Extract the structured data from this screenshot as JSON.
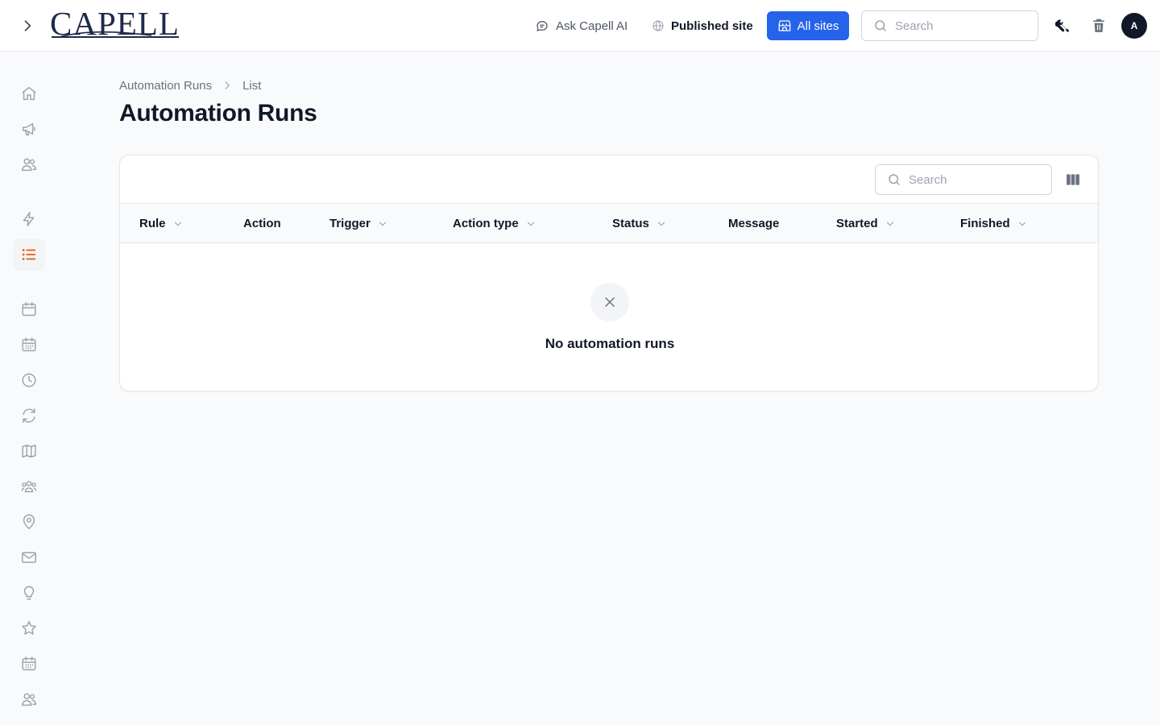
{
  "header": {
    "brand": "CAPELL",
    "ask_ai_label": "Ask Capell AI",
    "published_site_label": "Published site",
    "all_sites_label": "All sites",
    "search_placeholder": "Search",
    "avatar_initial": "A",
    "accent_color": "#2563eb"
  },
  "sidebar": {
    "active_item": "automation-runs",
    "active_color": "#ea580c",
    "items": [
      {
        "icon": "home-icon"
      },
      {
        "icon": "megaphone-icon"
      },
      {
        "icon": "users-icon"
      },
      {
        "icon": "bolt-icon"
      },
      {
        "icon": "list-icon"
      },
      {
        "icon": "calendar-icon"
      },
      {
        "icon": "calendar-days-icon"
      },
      {
        "icon": "clock-icon"
      },
      {
        "icon": "refresh-icon"
      },
      {
        "icon": "map-icon"
      },
      {
        "icon": "user-group-icon"
      },
      {
        "icon": "map-pin-icon"
      },
      {
        "icon": "envelope-icon"
      },
      {
        "icon": "light-bulb-icon"
      },
      {
        "icon": "star-icon"
      },
      {
        "icon": "calendar-days-icon"
      },
      {
        "icon": "users-icon"
      }
    ]
  },
  "breadcrumb": {
    "parent": "Automation Runs",
    "current": "List"
  },
  "page": {
    "title": "Automation Runs"
  },
  "table": {
    "search_placeholder": "Search",
    "columns": [
      {
        "label": "Rule",
        "sortable": true
      },
      {
        "label": "Action",
        "sortable": false
      },
      {
        "label": "Trigger",
        "sortable": true
      },
      {
        "label": "Action type",
        "sortable": true
      },
      {
        "label": "Status",
        "sortable": true
      },
      {
        "label": "Message",
        "sortable": false
      },
      {
        "label": "Started",
        "sortable": true
      },
      {
        "label": "Finished",
        "sortable": true
      }
    ],
    "rows": [],
    "empty_state": "No automation runs"
  }
}
